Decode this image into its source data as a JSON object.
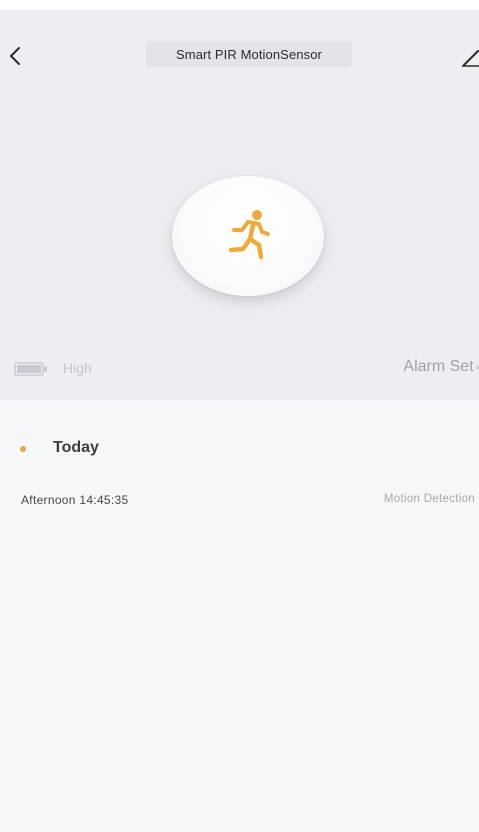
{
  "header": {
    "title": "Smart PIR MotionSensor",
    "back_icon": "chevron-left-icon",
    "edit_icon": "pencil-icon",
    "background": "#eceef1"
  },
  "sensor": {
    "icon": "running-person-icon",
    "icon_color": "#f0a93d"
  },
  "status_bar": {
    "battery_icon": "battery-icon",
    "battery_level": "High",
    "alarm_set_label": "Alarm Set"
  },
  "log": {
    "date_label": "Today",
    "dot_color": "#e9a446",
    "entries": [
      {
        "time": "Afternoon  14:45:35",
        "event": "Motion Detection"
      }
    ]
  }
}
